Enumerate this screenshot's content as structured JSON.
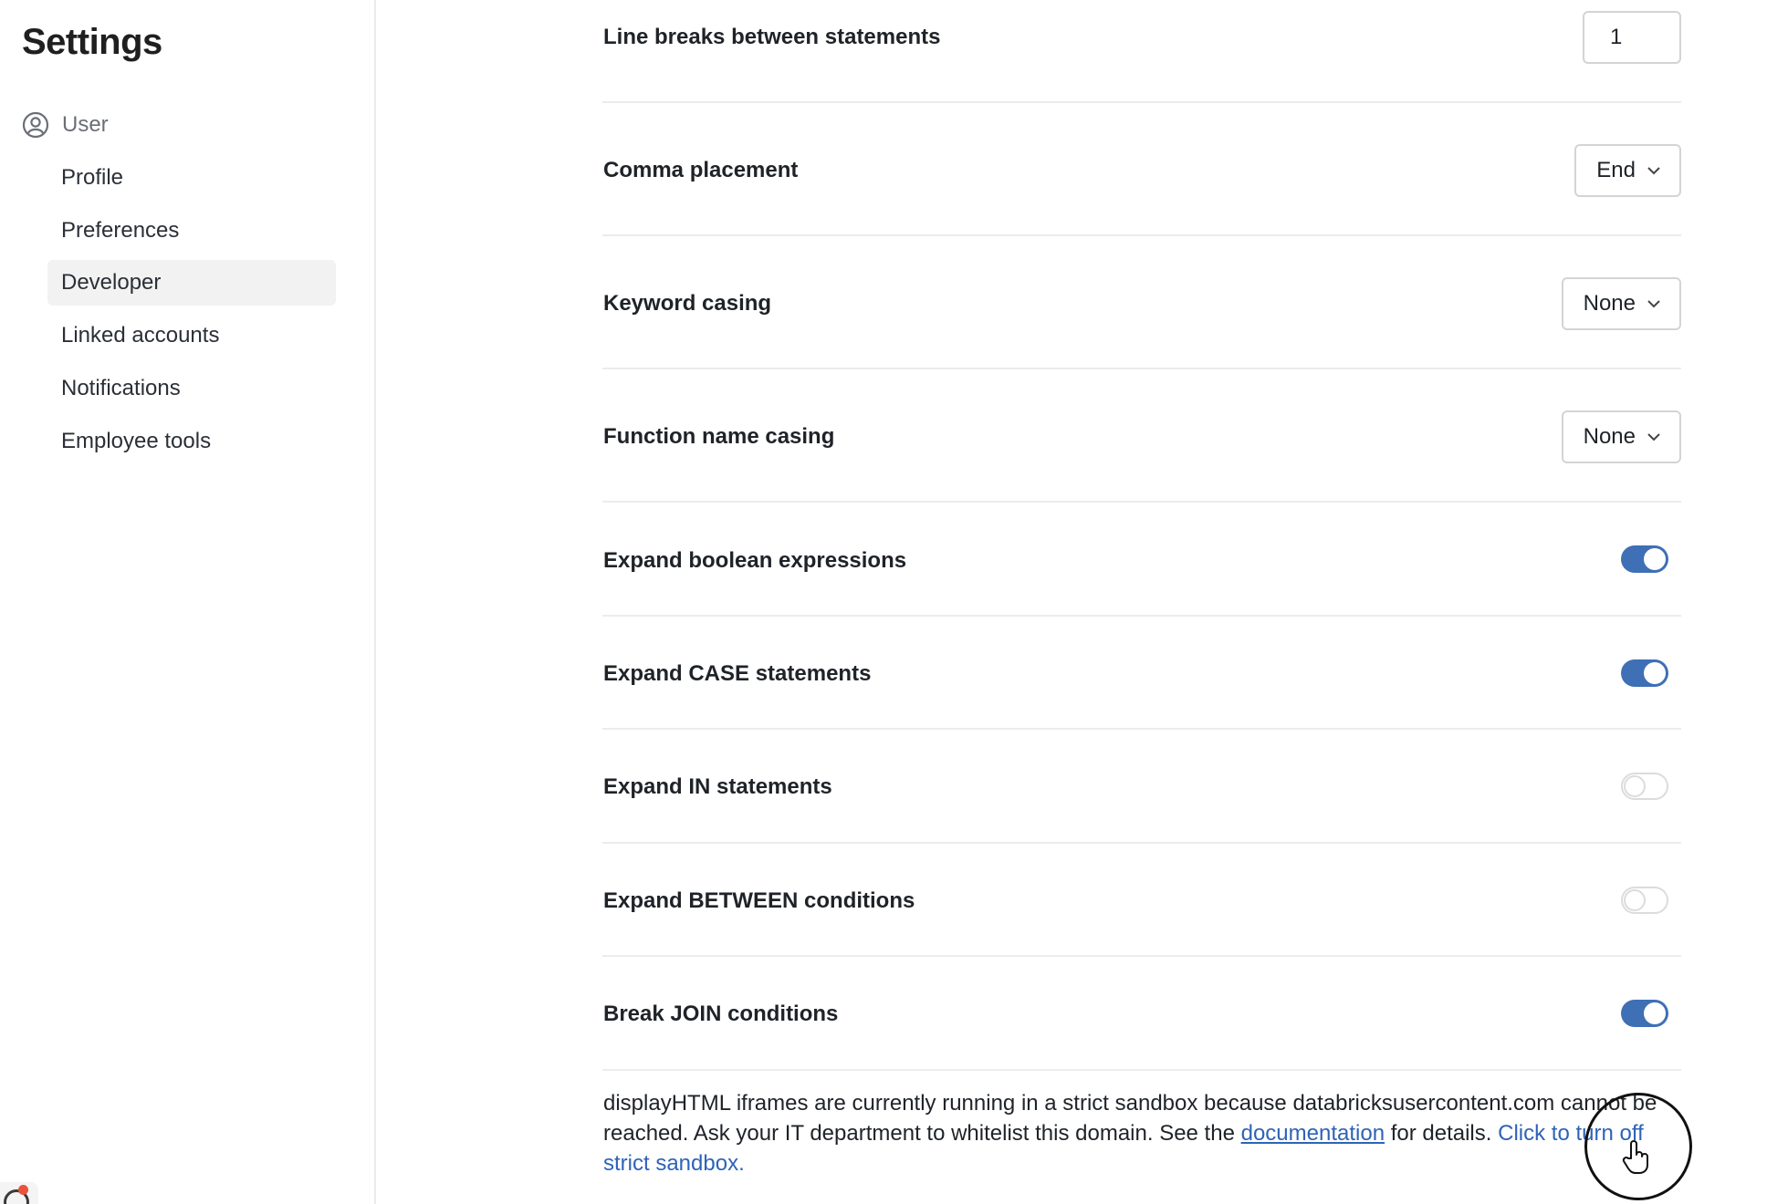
{
  "sidebar": {
    "title": "Settings",
    "section": {
      "label": "User",
      "icon": "user-circle-icon"
    },
    "items": [
      {
        "label": "Profile",
        "active": false
      },
      {
        "label": "Preferences",
        "active": false
      },
      {
        "label": "Developer",
        "active": true
      },
      {
        "label": "Linked accounts",
        "active": false
      },
      {
        "label": "Notifications",
        "active": false
      },
      {
        "label": "Employee tools",
        "active": false
      }
    ]
  },
  "settings": {
    "line_breaks": {
      "label": "Line breaks between statements",
      "value": "1"
    },
    "comma_placement": {
      "label": "Comma placement",
      "value": "End"
    },
    "keyword_casing": {
      "label": "Keyword casing",
      "value": "None"
    },
    "function_name_casing": {
      "label": "Function name casing",
      "value": "None"
    },
    "expand_boolean": {
      "label": "Expand boolean expressions",
      "enabled": true
    },
    "expand_case": {
      "label": "Expand CASE statements",
      "enabled": true
    },
    "expand_in": {
      "label": "Expand IN statements",
      "enabled": false
    },
    "expand_between": {
      "label": "Expand BETWEEN conditions",
      "enabled": false
    },
    "break_join": {
      "label": "Break JOIN conditions",
      "enabled": true
    }
  },
  "notice": {
    "text_before": "displayHTML iframes are currently running in a strict sandbox because databricksusercontent.com cannot be reached. Ask your IT department to whitelist this domain. See the ",
    "doc_link": "documentation",
    "text_after": " for details. ",
    "action_link": "Click to turn off strict sandbox."
  },
  "colors": {
    "accent": "#3f6fb5",
    "link": "#2e63b8",
    "active_nav_bg": "#f2f2f2",
    "divider": "#ececec",
    "notification_dot": "#e8543b"
  }
}
